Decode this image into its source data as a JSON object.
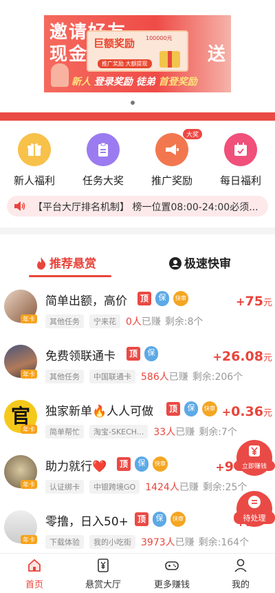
{
  "banner": {
    "line1": "邀请好友",
    "line2": "现金",
    "line2_end": "送",
    "card_title": "巨额奖励",
    "card_amount": "100000元",
    "card_sub": "推广奖励 大额提现",
    "bottom_a": "新人",
    "bottom_b": "登录奖励 徒弟",
    "bottom_c": "首登奖励"
  },
  "grid": [
    {
      "label": "新人福利",
      "icon": "gift-icon",
      "color": "#f7c14a"
    },
    {
      "label": "任务大奖",
      "icon": "clipboard-icon",
      "color": "#9b7cf0"
    },
    {
      "label": "推广奖励",
      "icon": "megaphone-icon",
      "color": "#f2774e",
      "badge": "大奖"
    },
    {
      "label": "每日福利",
      "icon": "calendar-icon",
      "color": "#f0507a"
    }
  ],
  "notice": {
    "text": "【平台大厅排名机制】 榜一位置08:00-24:00必须..."
  },
  "tabs": [
    {
      "label": "推荐悬赏",
      "icon": "fire-icon",
      "active": true
    },
    {
      "label": "极速快审",
      "icon": "person-icon",
      "active": false
    }
  ],
  "tag_labels": {
    "ding": "顶",
    "bao": "保",
    "kuai": "快审"
  },
  "tasks": [
    {
      "title": "简单出额，高价",
      "tags": [
        "ding",
        "bao",
        "kuai"
      ],
      "price_plus": "+",
      "price": "75",
      "unit": "元",
      "chip1": "其他任务",
      "chip2": "宁来花",
      "earned": "0人",
      "earned_suffix": "已赚",
      "remaining": "剩余:8个",
      "avatar_color": "#b98a6a",
      "nian": "年卡"
    },
    {
      "title": "免费领联通卡",
      "tags": [
        "ding",
        "bao"
      ],
      "price_plus": "+",
      "price": "26.08",
      "unit": "元",
      "chip1": "其他任务",
      "chip2": "中国联通卡",
      "earned": "586人",
      "earned_suffix": "已赚",
      "remaining": "剩余:206个",
      "avatar_color": "#6a6f8e",
      "nian": "年卡"
    },
    {
      "title": "独家新单🔥人人可做",
      "tags": [
        "ding",
        "bao",
        "kuai"
      ],
      "price_plus": "+",
      "price": "0.36",
      "unit": "元",
      "chip1": "简单帮忙",
      "chip2": "淘宝-SKECH...",
      "earned": "33人",
      "earned_suffix": "已赚",
      "remaining": "剩余:7个",
      "avatar_color": "#f5c91a",
      "nian": "年卡",
      "avatar_text": "官"
    },
    {
      "title": "助力就行❤️",
      "tags": [
        "ding",
        "bao",
        "kuai"
      ],
      "price_plus": "+",
      "price": "9",
      "unit": "元",
      "chip1": "认证绑卡",
      "chip2": "中银跨境GO",
      "earned": "1424人",
      "earned_suffix": "已赚",
      "remaining": "剩余:25个",
      "avatar_color": "#8a7a5e",
      "nian": "年卡"
    },
    {
      "title": "零撸，日入50+",
      "tags": [
        "ding",
        "bao",
        "kuai"
      ],
      "price_plus": "+",
      "price": "1",
      "unit": "元",
      "chip1": "下载体验",
      "chip2": "我的小吃街",
      "earned": "3973人",
      "earned_suffix": "已赚",
      "remaining": "剩余:164个",
      "avatar_color": "#d8d8d8",
      "nian": "年卡"
    }
  ],
  "float_buttons": [
    {
      "label": "立即赚钱",
      "icon": "yuan-icon"
    },
    {
      "label": "待处理",
      "icon": "list-icon"
    }
  ],
  "nav": [
    {
      "label": "首页",
      "icon": "home-icon",
      "active": true
    },
    {
      "label": "悬赏大厅",
      "icon": "yuan-doc-icon",
      "active": false
    },
    {
      "label": "更多赚钱",
      "icon": "gamepad-icon",
      "active": false
    },
    {
      "label": "我的",
      "icon": "user-icon",
      "active": false
    }
  ],
  "colors": {
    "accent": "#e8453c",
    "blue": "#5ca9e6",
    "orange": "#f4a623"
  }
}
